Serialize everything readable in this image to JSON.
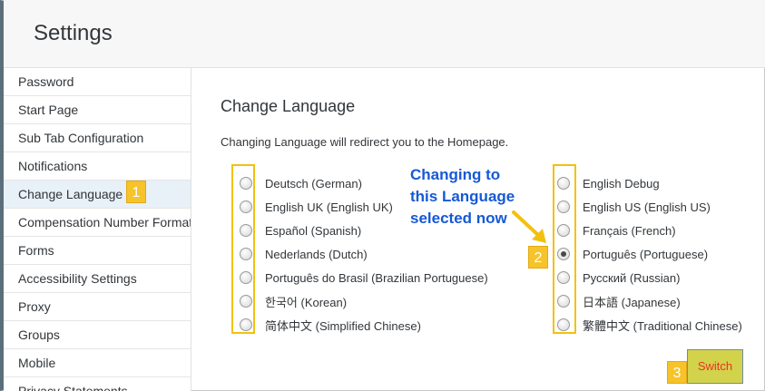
{
  "header": {
    "title": "Settings"
  },
  "sidebar": {
    "items": [
      {
        "label": "Password"
      },
      {
        "label": "Start Page"
      },
      {
        "label": "Sub Tab Configuration"
      },
      {
        "label": "Notifications"
      },
      {
        "label": "Change Language"
      },
      {
        "label": "Compensation Number Format"
      },
      {
        "label": "Forms"
      },
      {
        "label": "Accessibility Settings"
      },
      {
        "label": "Proxy"
      },
      {
        "label": "Groups"
      },
      {
        "label": "Mobile"
      },
      {
        "label": "Privacy Statements"
      }
    ]
  },
  "main": {
    "section_title": "Change Language",
    "description": "Changing Language will redirect you to the Homepage.",
    "left_options": [
      {
        "label": "Deutsch (German)"
      },
      {
        "label": "English UK (English UK)"
      },
      {
        "label": "Español (Spanish)"
      },
      {
        "label": "Nederlands (Dutch)"
      },
      {
        "label": "Português do Brasil (Brazilian Portuguese)"
      },
      {
        "label": "한국어 (Korean)"
      },
      {
        "label": "简体中文 (Simplified Chinese)"
      }
    ],
    "right_options": [
      {
        "label": "English Debug"
      },
      {
        "label": "English US (English US)"
      },
      {
        "label": "Français (French)"
      },
      {
        "label": "Português (Portuguese)"
      },
      {
        "label": "Русский (Russian)"
      },
      {
        "label": "日本語 (Japanese)"
      },
      {
        "label": "繁體中文 (Traditional Chinese)"
      }
    ],
    "switch_label": "Switch"
  },
  "annotations": {
    "badge1": "1",
    "badge2": "2",
    "badge3": "3",
    "callout_line1": "Changing to",
    "callout_line2": "this Language",
    "callout_line3": "selected now",
    "highlight_color": "#f2c10f",
    "callout_color": "#1559d6"
  }
}
